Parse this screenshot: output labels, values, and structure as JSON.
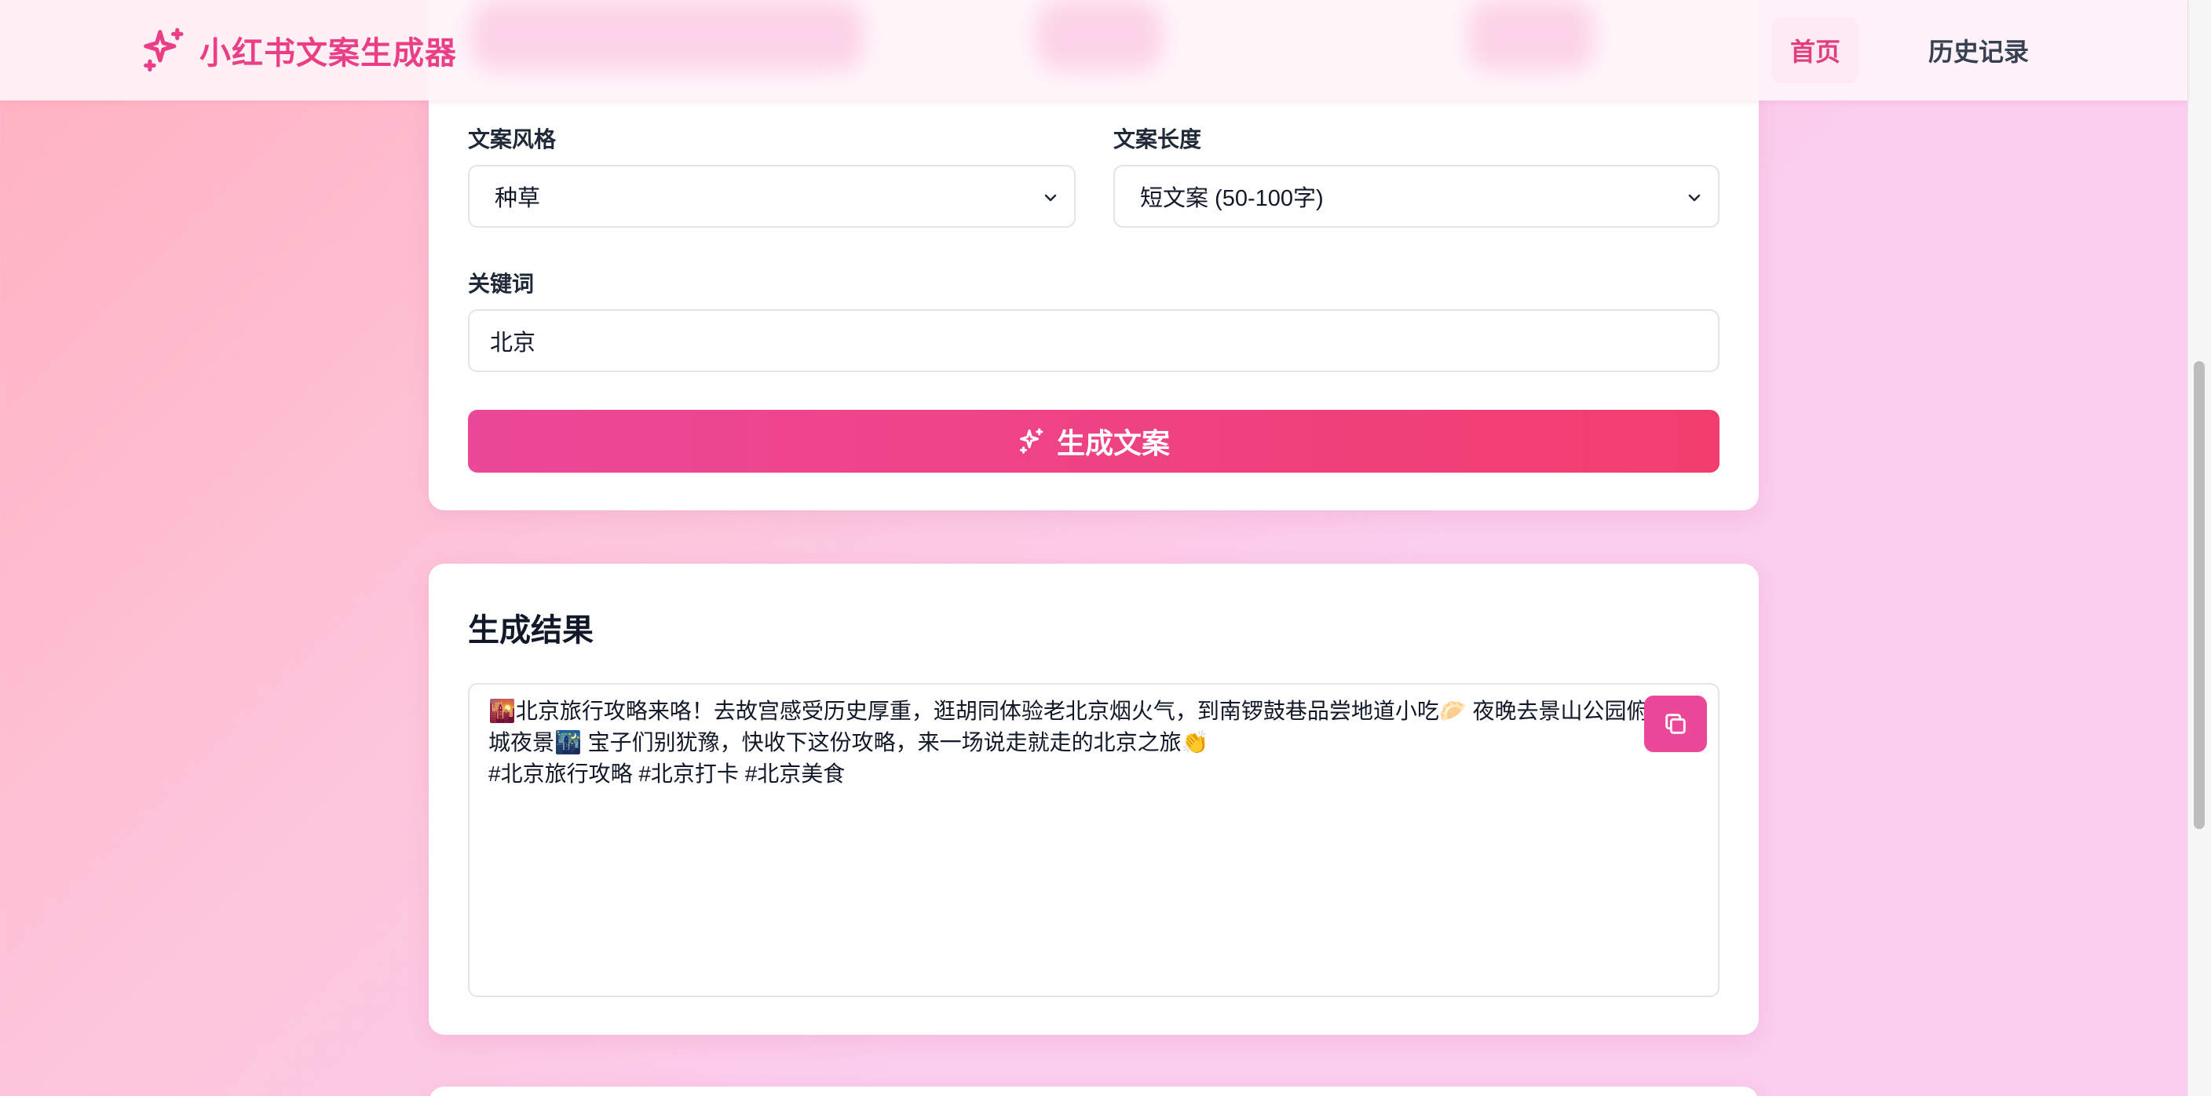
{
  "header": {
    "brand_title": "小红书文案生成器",
    "nav_home": "首页",
    "nav_history": "历史记录"
  },
  "form": {
    "style_label": "文案风格",
    "style_value": "种草",
    "length_label": "文案长度",
    "length_value": "短文案 (50-100字)",
    "keyword_label": "关键词",
    "keyword_value": "北京",
    "generate_button": "生成文案"
  },
  "result": {
    "title": "生成结果",
    "line1": "🌇北京旅行攻略来咯！去故宫感受历史厚重，逛胡同体验老北京烟火气，到南锣鼓巷品尝地道小吃🥟 夜晚去景山公园俯瞰",
    "line2": "城夜景🌃 宝子们别犹豫，快收下这份攻略，来一场说走就走的北京之旅👏",
    "line3": "#北京旅行攻略 #北京打卡 #北京美食"
  },
  "colors": {
    "accent": "#ec4899",
    "accent_end": "#f23d6e",
    "nav_active_text": "#e23d7e"
  },
  "icons": {
    "brand": "sparkles-icon",
    "generate": "sparkles-icon",
    "copy": "copy-icon",
    "select": "chevron-down-icon"
  }
}
